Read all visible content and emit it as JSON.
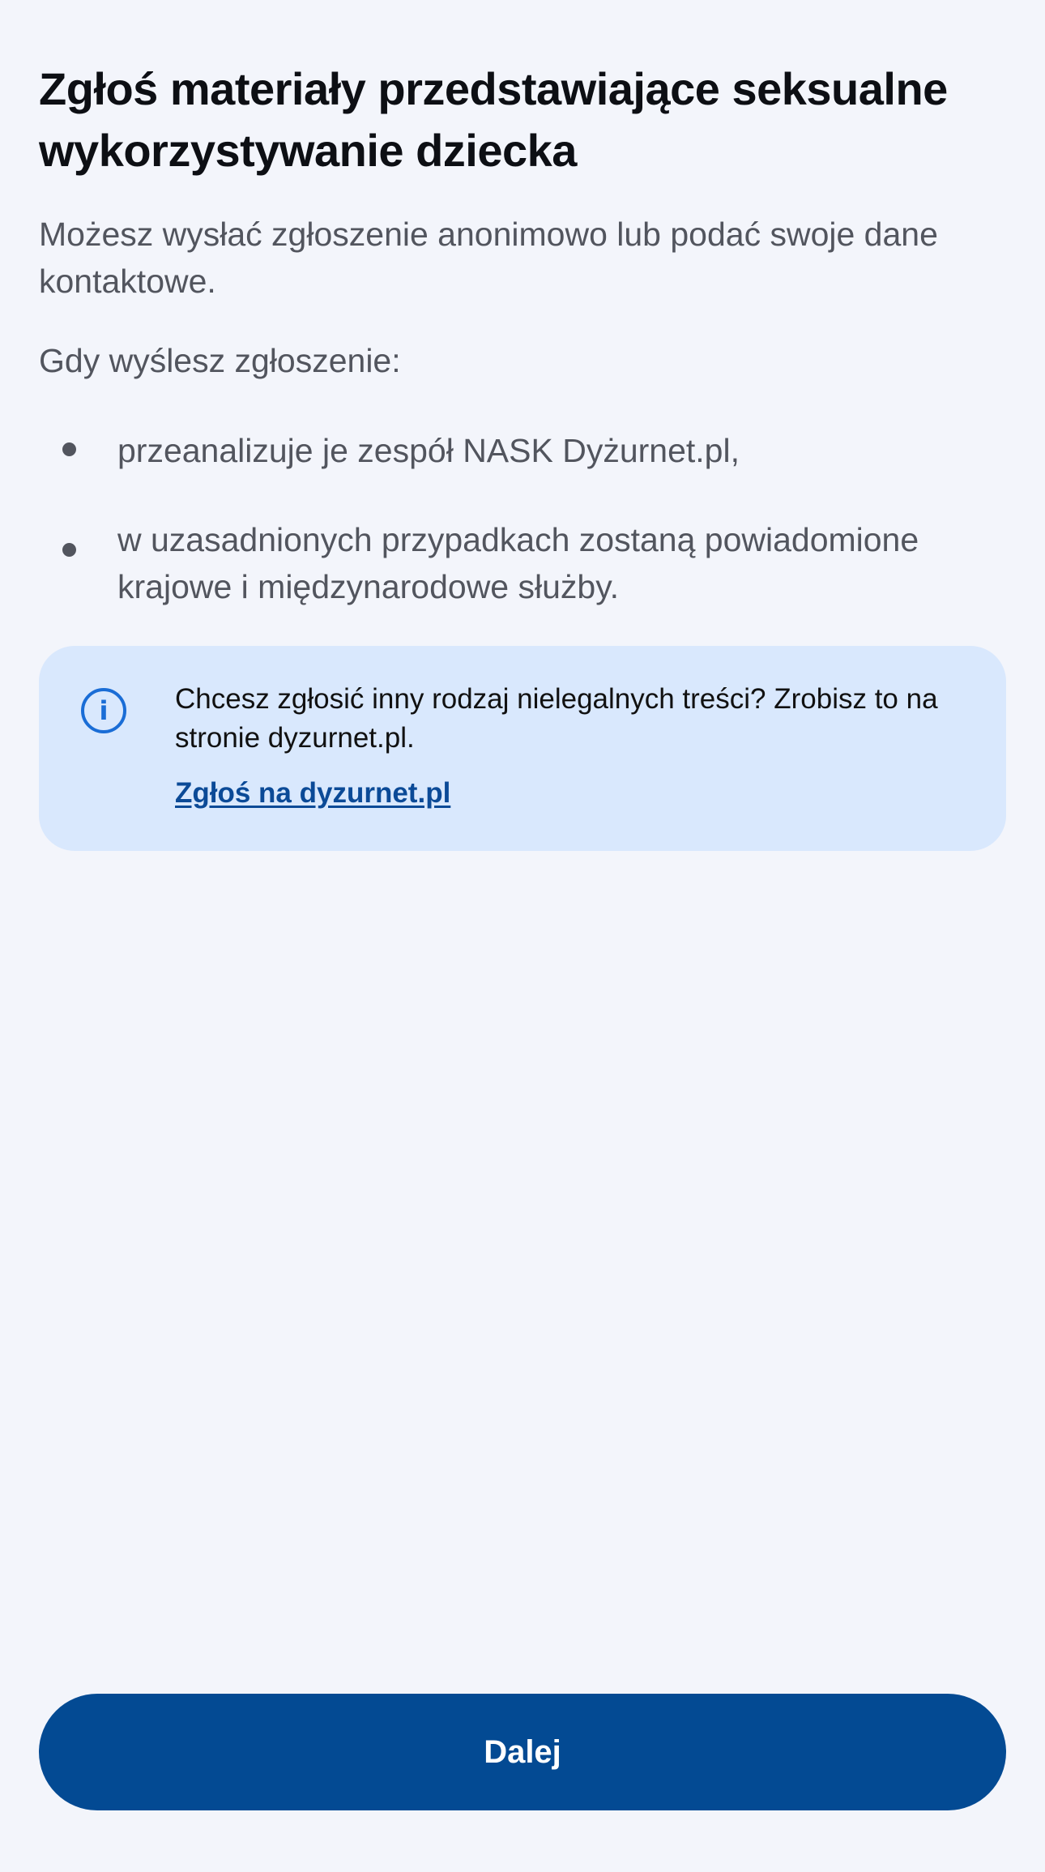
{
  "page": {
    "title": "Zgłoś materiały przedstawiające seksualne wykorzystywanie dziecka",
    "intro": "Możesz wysłać zgłoszenie anonimowo lub podać swoje dane kontaktowe.",
    "when_sent": "Gdy wyślesz zgłoszenie:",
    "bullets": [
      "przeanalizuje je zespół NASK Dyżurnet.pl,",
      "w uzasadnionych przypadkach zostaną powiadomione krajowe i międzynarodowe służby."
    ]
  },
  "info": {
    "icon": "info-icon",
    "icon_glyph": "i",
    "text": "Chcesz zgłosić inny rodzaj nielegalnych treści? Zrobisz to na stronie dyzurnet.pl.",
    "link_label": "Zgłoś na dyzurnet.pl"
  },
  "footer": {
    "next_button_label": "Dalej"
  },
  "colors": {
    "background": "#F3F5FB",
    "info_background": "#D9E8FD",
    "accent": "#034A93",
    "link": "#0B4A97",
    "info_icon": "#1A6DD6",
    "secondary_text": "#52555E"
  }
}
